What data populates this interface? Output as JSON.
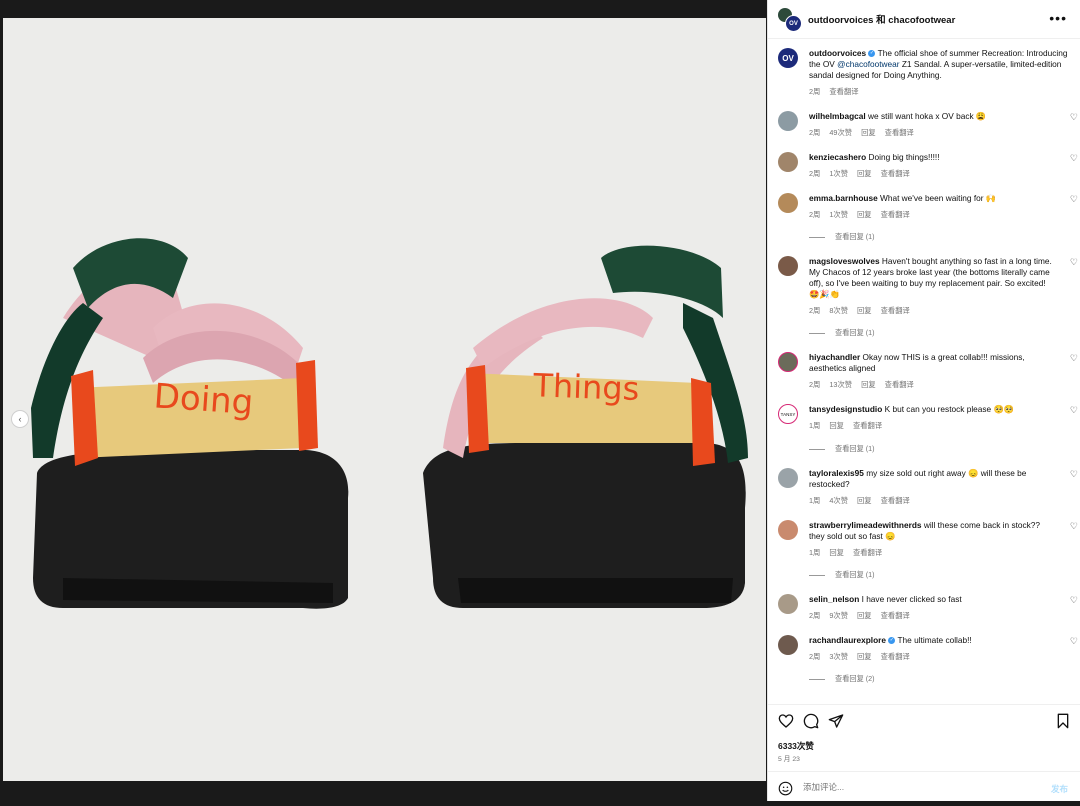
{
  "post": {
    "header_title": "outdoorvoices 和 chacofootwear",
    "avatar_text": "OV",
    "caption": {
      "user": "outdoorvoices",
      "text_before_mention": "The official shoe of summer Recreation: Introducing the OV ",
      "mention": "@chacofootwear",
      "text_after_mention": " Z1 Sandal. A super-versatile, limited-edition sandal designed for Doing Anything.",
      "time": "2周",
      "translate": "查看翻译"
    },
    "image_text": {
      "left_strap": "Doing",
      "right_strap": "Things"
    }
  },
  "comments": [
    {
      "user": "wilhelmbagcal",
      "text": "we still want hoka x OV back 😩",
      "time": "2周",
      "likes": "49次赞",
      "reply": "回复",
      "translate": "查看翻译"
    },
    {
      "user": "kenziecashero",
      "text": "Doing big things!!!!!",
      "time": "2周",
      "likes": "1次赞",
      "reply": "回复",
      "translate": "查看翻译"
    },
    {
      "user": "emma.barnhouse",
      "text": "What we've been waiting for 🙌",
      "time": "2周",
      "likes": "1次赞",
      "reply": "回复",
      "translate": "查看翻译",
      "view_replies": "查看回复 (1)"
    },
    {
      "user": "magsloveswolves",
      "text": "Haven't bought anything so fast in a long time. My Chacos of 12 years broke last year (the bottoms literally came off), so I've been waiting to buy my replacement pair. So excited! 🤩🎉👏",
      "time": "2周",
      "likes": "8次赞",
      "reply": "回复",
      "translate": "查看翻译",
      "view_replies": "查看回复 (1)"
    },
    {
      "user": "hiyachandler",
      "text": "Okay now THIS is a great collab!!! missions, aesthetics aligned",
      "time": "2周",
      "likes": "13次赞",
      "reply": "回复",
      "translate": "查看翻译"
    },
    {
      "user": "tansydesignstudio",
      "text": "K but can you restock please 🥺🥺",
      "time": "1周",
      "likes": "",
      "reply": "回复",
      "translate": "查看翻译",
      "view_replies": "查看回复 (1)",
      "avatar_text": "TANSY"
    },
    {
      "user": "tayloralexis95",
      "text": "my size sold out right away 😞 will these be restocked?",
      "time": "1周",
      "likes": "4次赞",
      "reply": "回复",
      "translate": "查看翻译"
    },
    {
      "user": "strawberrylimeadewithnerds",
      "text": "will these come back in stock?? they sold out so fast 😞",
      "time": "1周",
      "likes": "",
      "reply": "回复",
      "translate": "查看翻译",
      "view_replies": "查看回复 (1)"
    },
    {
      "user": "selin_nelson",
      "text": "I have never clicked so fast",
      "time": "2周",
      "likes": "9次赞",
      "reply": "回复",
      "translate": "查看翻译"
    },
    {
      "user": "rachandlaurexplore",
      "text": "The ultimate collab!!",
      "time": "2周",
      "likes": "3次赞",
      "reply": "回复",
      "translate": "查看翻译",
      "view_replies": "查看回复 (2)",
      "verified": true
    }
  ],
  "footer": {
    "likes": "6333次赞",
    "date": "5 月 23",
    "add_comment_placeholder": "添加评论...",
    "post_label": "发布"
  },
  "icons": [
    "heart-icon",
    "comment-icon",
    "share-icon",
    "bookmark-icon",
    "emoji-icon",
    "more-icon",
    "verified-icon",
    "chevron-left-icon"
  ],
  "colors": {
    "ov_brand": "#1c2a7a",
    "verified": "#3897f0",
    "mention": "#00376b",
    "post_disabled": "#b2dffc"
  }
}
